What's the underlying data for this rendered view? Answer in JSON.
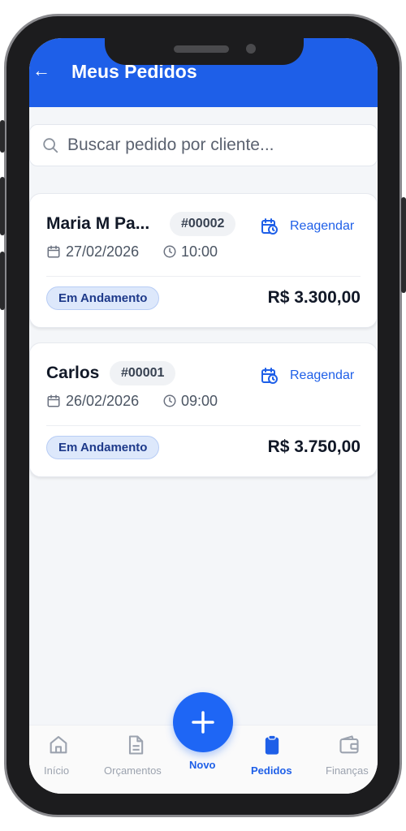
{
  "header": {
    "back_icon": "arrow-left-icon",
    "title": "Meus Pedidos",
    "color": "#1e5fe8"
  },
  "search": {
    "placeholder": "Buscar pedido por cliente...",
    "value": "",
    "icon": "search-icon"
  },
  "orders": [
    {
      "client": "Maria M Pa...",
      "id": "#00002",
      "date": "27/02/2026",
      "time": "10:00",
      "reschedule_label": "Reagendar",
      "status": "Em Andamento",
      "total": "R$ 3.300,00"
    },
    {
      "client": "Carlos",
      "id": "#00001",
      "date": "26/02/2026",
      "time": "09:00",
      "reschedule_label": "Reagendar",
      "status": "Em Andamento",
      "total": "R$ 3.750,00"
    }
  ],
  "nav": {
    "items": [
      {
        "label": "Início",
        "icon": "home-icon",
        "active": false
      },
      {
        "label": "Orçamentos",
        "icon": "document-icon",
        "active": false
      },
      {
        "label": "Novo",
        "icon": "plus-icon",
        "active": false
      },
      {
        "label": "Pedidos",
        "icon": "clipboard-icon",
        "active": true
      },
      {
        "label": "Finanças",
        "icon": "wallet-icon",
        "active": false
      }
    ]
  },
  "colors": {
    "accent": "#1e5fe8",
    "status_bg": "#dde8fb",
    "status_text": "#1e3a8a"
  }
}
